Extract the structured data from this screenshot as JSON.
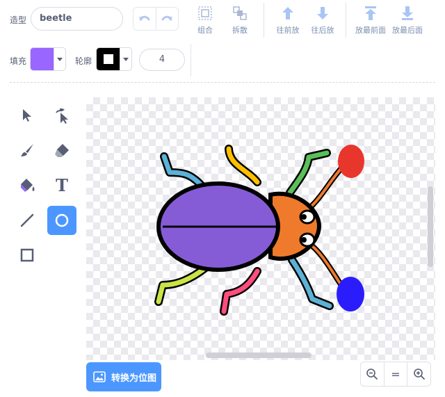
{
  "costume": {
    "label": "造型",
    "name": "beetle"
  },
  "toolbar": {
    "group_label": "组合",
    "ungroup_label": "拆散",
    "forward_label": "往前放",
    "backward_label": "往后放",
    "front_label": "放最前面",
    "back_label": "放最后面"
  },
  "style": {
    "fill_label": "填充",
    "fill_color": "#9966ff",
    "outline_label": "轮廓",
    "outline_color": "#000000",
    "outline_width": "4"
  },
  "tools": [
    {
      "name": "select-tool",
      "icon": "arrow-icon"
    },
    {
      "name": "reshape-tool",
      "icon": "reshape-icon"
    },
    {
      "name": "brush-tool",
      "icon": "brush-icon"
    },
    {
      "name": "eraser-tool",
      "icon": "eraser-icon"
    },
    {
      "name": "fill-tool",
      "icon": "bucket-icon"
    },
    {
      "name": "text-tool",
      "icon": "text-icon",
      "glyph": "T"
    },
    {
      "name": "line-tool",
      "icon": "line-icon"
    },
    {
      "name": "circle-tool",
      "icon": "circle-icon",
      "active": true
    },
    {
      "name": "rectangle-tool",
      "icon": "rectangle-icon"
    }
  ],
  "bottom": {
    "convert_label": "转换为位图",
    "zoom_reset_glyph": "="
  },
  "colors": {
    "accent": "#4c97ff",
    "beetle_body": "#855cd6",
    "beetle_head": "#f07a2b",
    "antenna_red": "#e8362c",
    "antenna_blue": "#2b1dfb"
  }
}
